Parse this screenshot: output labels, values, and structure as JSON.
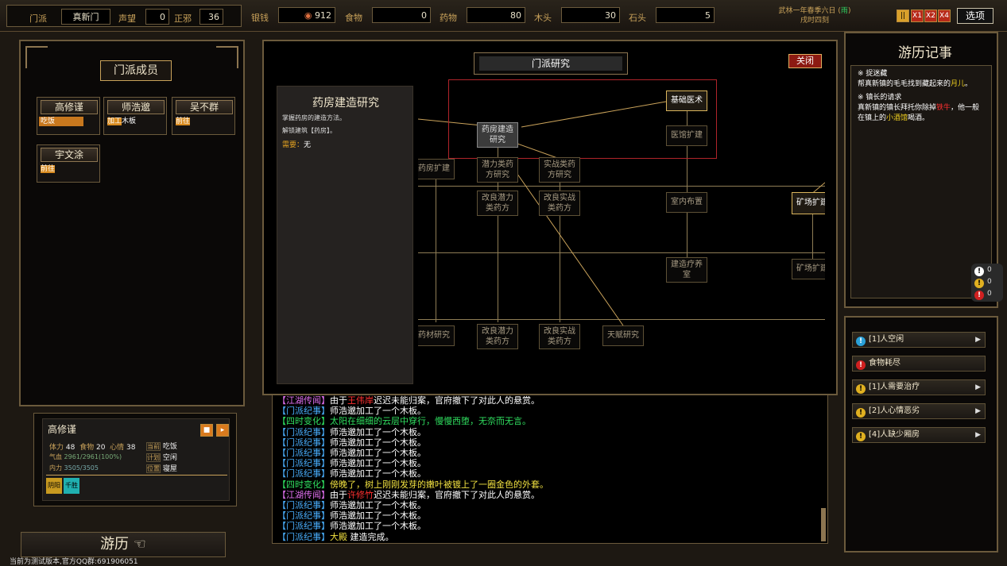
{
  "topbar": {
    "sect_label": "门派",
    "sect_name": "真新门",
    "rep_label": "声望",
    "rep_value": "0",
    "align_label": "正邪",
    "align_value": "36",
    "res": [
      {
        "label": "银钱",
        "value": "912"
      },
      {
        "label": "食物",
        "value": "0"
      },
      {
        "label": "药物",
        "value": "80"
      },
      {
        "label": "木头",
        "value": "30"
      },
      {
        "label": "石头",
        "value": "5"
      }
    ],
    "date_line1": "武林一年春季六日",
    "weather": "雨",
    "date_line2": "戌时四刻",
    "speeds": [
      "||",
      "X1",
      "X2",
      "X4"
    ],
    "options_label": "选项"
  },
  "members": {
    "title": "门派成员",
    "cards": [
      {
        "name": "高修谨",
        "action": "吃饭",
        "color": "#c8781e",
        "type": "bar"
      },
      {
        "name": "师浩邈",
        "action_tag": "加工",
        "action": "木板",
        "color": "#d88a1e",
        "type": "tag"
      },
      {
        "name": "吴不群",
        "action_tag": "前往",
        "action": "",
        "color": "#d88a1e",
        "type": "tag"
      },
      {
        "name": "宇文涂",
        "action_tag": "前往",
        "action": "",
        "color": "#d88a1e",
        "type": "tag"
      }
    ]
  },
  "detail": {
    "name": "高修谨",
    "stamina_label": "体力",
    "stamina": "48",
    "food_label": "食物",
    "food": "20",
    "mood_label": "心情",
    "mood": "38",
    "hp_label": "气血",
    "hp": "2961/2961(100%)",
    "mp_label": "内力",
    "mp": "3505/3505",
    "cur_label": "当前",
    "cur": "吃饭",
    "plan_label": "计划",
    "plan": "空闲",
    "pos_label": "位置",
    "pos": "寝屋",
    "tags": [
      "阴阳",
      "千胜"
    ]
  },
  "travel_label": "游历",
  "version": "当前为测试版本,官方QQ群:691906051",
  "research": {
    "title": "门派研究",
    "close": "关闭",
    "info_title": "药房建造研究",
    "info_desc1": "掌握药房的建造方法。",
    "info_desc2": "解锁建筑【药房】。",
    "req_label": "需要：",
    "req_value": "无",
    "nodes": {
      "n1": "基础医术",
      "n2": "药房建造研究",
      "n3": "医馆扩建",
      "n4": "药房扩建",
      "n5": "潜力类药方研究",
      "n6": "实战类药方研究",
      "n7": "改良潜力类药方",
      "n8": "改良实战类药方",
      "n9": "室内布置",
      "n10": "矿场扩建",
      "n11": "建造疗养室",
      "n12": "矿场扩建",
      "n13": "药材研究",
      "n14": "改良潜力类药方",
      "n15": "改良实战类药方",
      "n16": "天赋研究"
    }
  },
  "log": [
    {
      "tag": "【江湖传闻】",
      "tagc": "#e070f0",
      "parts": [
        [
          "由于",
          "#fff"
        ],
        [
          "王伟岸",
          "#ff3030"
        ],
        [
          "迟迟未能归案，官府撤下了对此人的悬赏。",
          "#fff"
        ]
      ]
    },
    {
      "tag": "【门派纪事】",
      "tagc": "#4ab0ff",
      "parts": [
        [
          "师浩邈加工了一个木板。",
          "#fff"
        ]
      ]
    },
    {
      "tag": "【四时变化】",
      "tagc": "#30e060",
      "parts": [
        [
          "太阳在细细的云层中穿行，慢慢西堕，无奈而无言。",
          "#30e060"
        ]
      ]
    },
    {
      "tag": "【门派纪事】",
      "tagc": "#4ab0ff",
      "parts": [
        [
          "师浩邈加工了一个木板。",
          "#fff"
        ]
      ]
    },
    {
      "tag": "【门派纪事】",
      "tagc": "#4ab0ff",
      "parts": [
        [
          "师浩邈加工了一个木板。",
          "#fff"
        ]
      ]
    },
    {
      "tag": "【门派纪事】",
      "tagc": "#4ab0ff",
      "parts": [
        [
          "师浩邈加工了一个木板。",
          "#fff"
        ]
      ]
    },
    {
      "tag": "【门派纪事】",
      "tagc": "#4ab0ff",
      "parts": [
        [
          "师浩邈加工了一个木板。",
          "#fff"
        ]
      ]
    },
    {
      "tag": "【门派纪事】",
      "tagc": "#4ab0ff",
      "parts": [
        [
          "师浩邈加工了一个木板。",
          "#fff"
        ]
      ]
    },
    {
      "tag": "【四时变化】",
      "tagc": "#30e060",
      "parts": [
        [
          "傍晚了，树上刚刚发芽的嫩叶被镀上了一圈金色的外套。",
          "#f0e040"
        ]
      ]
    },
    {
      "tag": "【江湖传闻】",
      "tagc": "#e070f0",
      "parts": [
        [
          "由于",
          "#fff"
        ],
        [
          "许修竹",
          "#ff3030"
        ],
        [
          "迟迟未能归案，官府撤下了对此人的悬赏。",
          "#fff"
        ]
      ]
    },
    {
      "tag": "【门派纪事】",
      "tagc": "#4ab0ff",
      "parts": [
        [
          "师浩邈加工了一个木板。",
          "#fff"
        ]
      ]
    },
    {
      "tag": "【门派纪事】",
      "tagc": "#4ab0ff",
      "parts": [
        [
          "师浩邈加工了一个木板。",
          "#fff"
        ]
      ]
    },
    {
      "tag": "【门派纪事】",
      "tagc": "#4ab0ff",
      "parts": [
        [
          "师浩邈加工了一个木板。",
          "#fff"
        ]
      ]
    },
    {
      "tag": "【门派纪事】",
      "tagc": "#4ab0ff",
      "parts": [
        [
          "大殿",
          "#f0e040"
        ],
        [
          " 建造完成。",
          "#fff"
        ]
      ]
    }
  ],
  "journal": {
    "title": "游历记事",
    "q1_title": "※ 捉迷藏",
    "q1_a": "帮真新镇的毛毛找到藏起来的",
    "q1_b": "月儿",
    "q1_c": "。",
    "q2_title": "※ 镇长的请求",
    "q2_a": "真新镇的镇长拜托你除掉",
    "q2_b": "铁牛",
    "q2_c": "，他一般在镇上的",
    "q2_d": "小酒馆",
    "q2_e": "喝酒。"
  },
  "counters": [
    "0",
    "0",
    "0"
  ],
  "alerts": [
    {
      "label": "[1]人空闲",
      "color": "#2aa0d8",
      "arrow": true
    },
    {
      "label": "食物耗尽",
      "color": "#d02020",
      "arrow": false
    },
    {
      "label": "[1]人需要治疗",
      "color": "#e0b020",
      "arrow": true
    },
    {
      "label": "[2]人心情恶劣",
      "color": "#e0b020",
      "arrow": true
    },
    {
      "label": "[4]人缺少厢房",
      "color": "#e0b020",
      "arrow": true
    }
  ]
}
